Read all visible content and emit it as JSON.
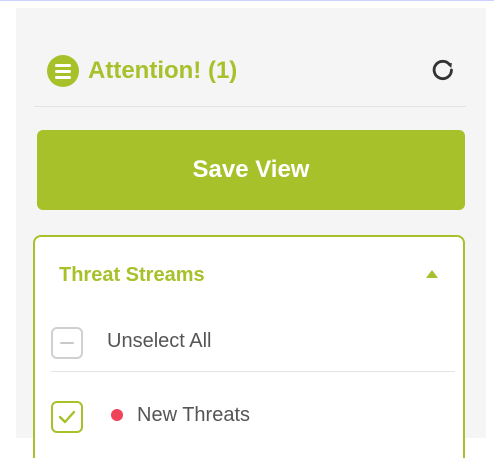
{
  "header": {
    "title": "Attention! (1)",
    "icon": "list-icon",
    "refresh_icon": "refresh-icon"
  },
  "actions": {
    "save_view_label": "Save View"
  },
  "threat_streams": {
    "title": "Threat Streams",
    "collapse_icon": "caret-up-icon",
    "unselect_all_label": "Unselect All",
    "items": [
      {
        "label": "New Threats",
        "checked": true,
        "dot_color": "#f0435a"
      }
    ]
  },
  "colors": {
    "accent": "#a7c12a",
    "text": "#555555",
    "border": "#d0d0d0",
    "danger": "#f0435a"
  }
}
